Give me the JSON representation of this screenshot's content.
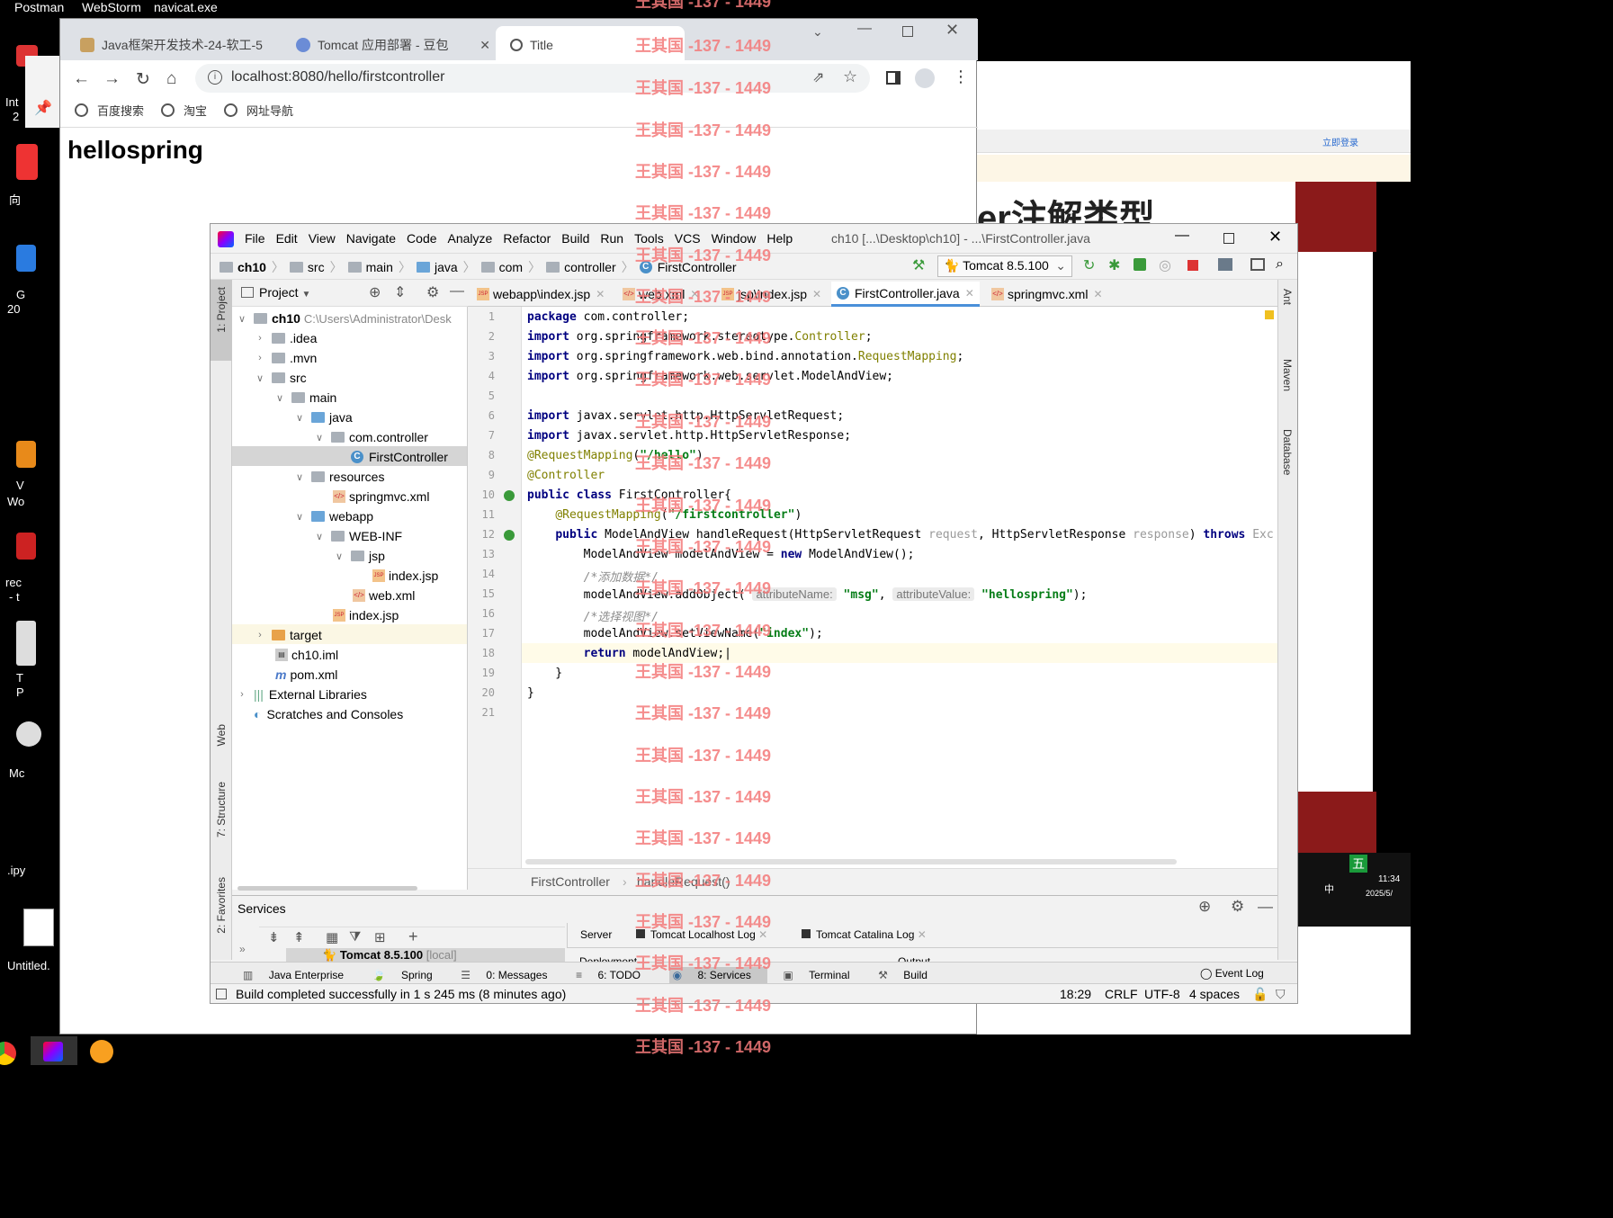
{
  "taskbar_top": [
    "Postman",
    "WebStorm",
    "navicat.exe"
  ],
  "desktop_items": [
    "Int",
    "2",
    "向",
    "G",
    "20",
    "V",
    "Wo",
    "rec",
    "- t",
    "T",
    "P",
    "Mc",
    ".ipy",
    "Untitled."
  ],
  "chrome": {
    "tabs": [
      {
        "title": "Java框架开发技术-24-软工-5"
      },
      {
        "title": "Tomcat 应用部署 - 豆包"
      },
      {
        "title": "Title"
      }
    ],
    "address": "localhost:8080/hello/firstcontroller",
    "bookmarks": [
      "百度搜索",
      "淘宝",
      "网址导航"
    ],
    "page_heading": "hellospring"
  },
  "right_window": {
    "login": "立即登录",
    "heading": "er注解类型",
    "time": "11:34",
    "date": "2025/5/",
    "ime": "五",
    "ime_label": "中"
  },
  "ide": {
    "menu": [
      "File",
      "Edit",
      "View",
      "Navigate",
      "Code",
      "Analyze",
      "Refactor",
      "Build",
      "Run",
      "Tools",
      "VCS",
      "Window",
      "Help"
    ],
    "title": "ch10 [...\\Desktop\\ch10] - ...\\FirstController.java",
    "breadcrumb": [
      "ch10",
      "src",
      "main",
      "java",
      "com",
      "controller",
      "FirstController"
    ],
    "run_config": "Tomcat 8.5.100",
    "project_label": "Project",
    "project_root": "ch10",
    "project_path": "C:\\Users\\Administrator\\Desk",
    "tree": [
      ".idea",
      ".mvn",
      "src",
      "main",
      "java",
      "com.controller",
      "FirstController",
      "resources",
      "springmvc.xml",
      "webapp",
      "WEB-INF",
      "jsp",
      "index.jsp",
      "web.xml",
      "index.jsp",
      "target",
      "ch10.iml",
      "pom.xml",
      "External Libraries",
      "Scratches and Consoles"
    ],
    "editor_tabs": [
      "webapp\\index.jsp",
      "web.xml",
      "jsp\\index.jsp",
      "FirstController.java",
      "springmvc.xml"
    ],
    "line_numbers": [
      "1",
      "2",
      "3",
      "4",
      "5",
      "6",
      "7",
      "8",
      "9",
      "10",
      "11",
      "12",
      "13",
      "14",
      "15",
      "16",
      "17",
      "18",
      "19",
      "20",
      "21"
    ],
    "editor_breadcrumb": [
      "FirstController",
      "handleRequest()"
    ],
    "left_tools": [
      "1: Project",
      "Web",
      "7: Structure",
      "2: Favorites"
    ],
    "right_tools": [
      "Ant",
      "Maven",
      "Database"
    ],
    "services": {
      "title": "Services",
      "tabs": [
        "Server",
        "Tomcat Localhost Log",
        "Tomcat Catalina Log"
      ],
      "server_item": "Tomcat 8.5.100",
      "server_suffix": "[local]",
      "deploy_label": "Deployment",
      "output_label": "Output"
    },
    "bottom_tools": [
      "Java Enterprise",
      "Spring",
      "0: Messages",
      "6: TODO",
      "8: Services",
      "Terminal",
      "Build"
    ],
    "event_log": "Event Log",
    "status": {
      "message": "Build completed successfully in 1 s 245 ms (8 minutes ago)",
      "position": "18:29",
      "line_sep": "CRLF",
      "encoding": "UTF-8",
      "indent": "4 spaces"
    }
  },
  "watermark": "王其国 -137 - 1449"
}
